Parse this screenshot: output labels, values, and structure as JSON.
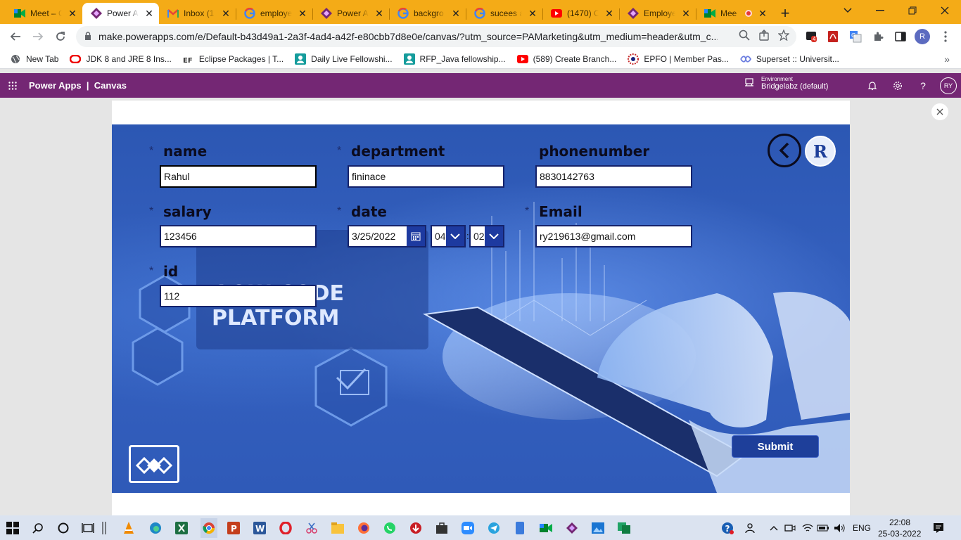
{
  "browser": {
    "tabs": [
      {
        "title": "Meet – C",
        "icon": "google-meet-icon",
        "active": false
      },
      {
        "title": "Power A",
        "icon": "power-apps-icon",
        "active": true
      },
      {
        "title": "Inbox (1",
        "icon": "gmail-icon",
        "active": false
      },
      {
        "title": "employe",
        "icon": "google-icon",
        "active": false
      },
      {
        "title": "Power A",
        "icon": "power-apps-icon",
        "active": false
      },
      {
        "title": "backgro",
        "icon": "google-icon",
        "active": false
      },
      {
        "title": "sucees a",
        "icon": "google-icon",
        "active": false
      },
      {
        "title": "(1470) C",
        "icon": "youtube-icon",
        "active": false
      },
      {
        "title": "Employe",
        "icon": "power-apps-icon",
        "active": false
      },
      {
        "title": "Mee",
        "icon": "google-meet-icon",
        "active": false
      }
    ],
    "url": "make.powerapps.com/e/Default-b43d49a1-2a3f-4ad4-a42f-e80cbb7d8e0e/canvas/?utm_source=PAMarketing&utm_medium=header&utm_c...",
    "profile_initial": "R",
    "ext_badge": "4",
    "bookmarks": [
      {
        "label": "New Tab",
        "icon": "globe-icon"
      },
      {
        "label": "JDK 8 and JRE 8 Ins...",
        "icon": "oracle-icon"
      },
      {
        "label": "Eclipse Packages | T...",
        "icon": "eclipse-icon"
      },
      {
        "label": "Daily Live Fellowshi...",
        "icon": "person-icon"
      },
      {
        "label": "RFP_Java fellowship...",
        "icon": "person-icon"
      },
      {
        "label": "(589) Create Branch...",
        "icon": "youtube-icon"
      },
      {
        "label": "EPFO | Member Pas...",
        "icon": "epfo-icon"
      },
      {
        "label": "Superset :: Universit...",
        "icon": "superset-icon"
      }
    ]
  },
  "powerapps": {
    "title": "Power Apps  |  Canvas",
    "environment_label": "Environment",
    "environment_value": "Bridgelabz (default)",
    "user_initials": "RY"
  },
  "form": {
    "name": {
      "label": "name",
      "value": "Rahul",
      "required": "*"
    },
    "department": {
      "label": "department",
      "value": "fininace",
      "required": "*"
    },
    "phonenumber": {
      "label": "phonenumber",
      "value": "8830142763"
    },
    "salary": {
      "label": "salary",
      "value": "123456",
      "required": "*"
    },
    "date": {
      "label": "date",
      "value": "3/25/2022",
      "hour": "04",
      "minute": "02",
      "required": "*",
      "separator": ":"
    },
    "email": {
      "label": "Email",
      "value": "ry219613@gmail.com",
      "required": "*"
    },
    "id": {
      "label": "id",
      "value": "112",
      "required": "*"
    },
    "submit_label": "Submit",
    "logo_text": "R",
    "background_text_1": "LOW CODE",
    "background_text_2": "PLATFORM"
  },
  "taskbar": {
    "lang": "ENG",
    "time": "22:08",
    "date": "25-03-2022"
  },
  "colors": {
    "chrome_tabstrip": "#f4ab17",
    "powerapps_header": "#742774",
    "app_background": "#2f5ab8",
    "input_border": "#14226b",
    "submit_bg": "#1e3f9a"
  }
}
